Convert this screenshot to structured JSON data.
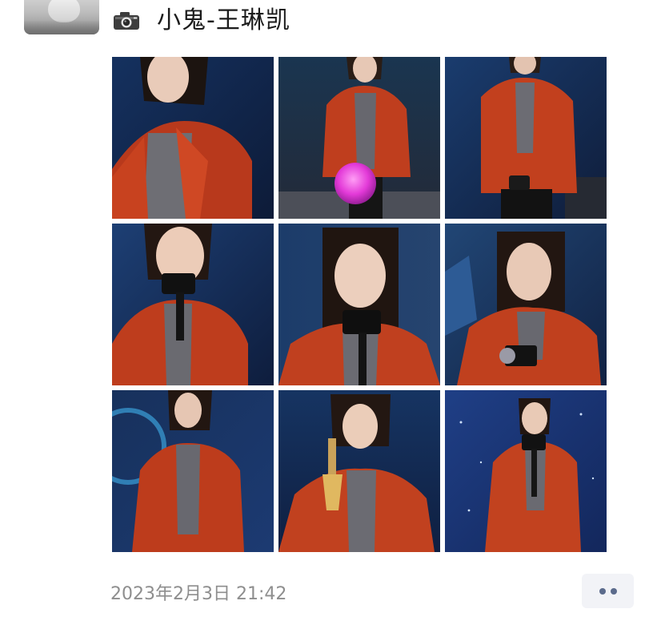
{
  "post": {
    "author_name": "小鬼-王琳凯",
    "timestamp": "2023年2月3日 21:42",
    "image_count": 9
  },
  "icons": {
    "camera": "camera-icon",
    "more": "more-dots-icon"
  },
  "colors": {
    "name_text": "#1b1b1b",
    "timestamp_text": "#8e8e8e",
    "more_button_bg": "#f2f3f7",
    "more_button_dots": "#5b6b8c",
    "jacket": "#c9401f"
  }
}
